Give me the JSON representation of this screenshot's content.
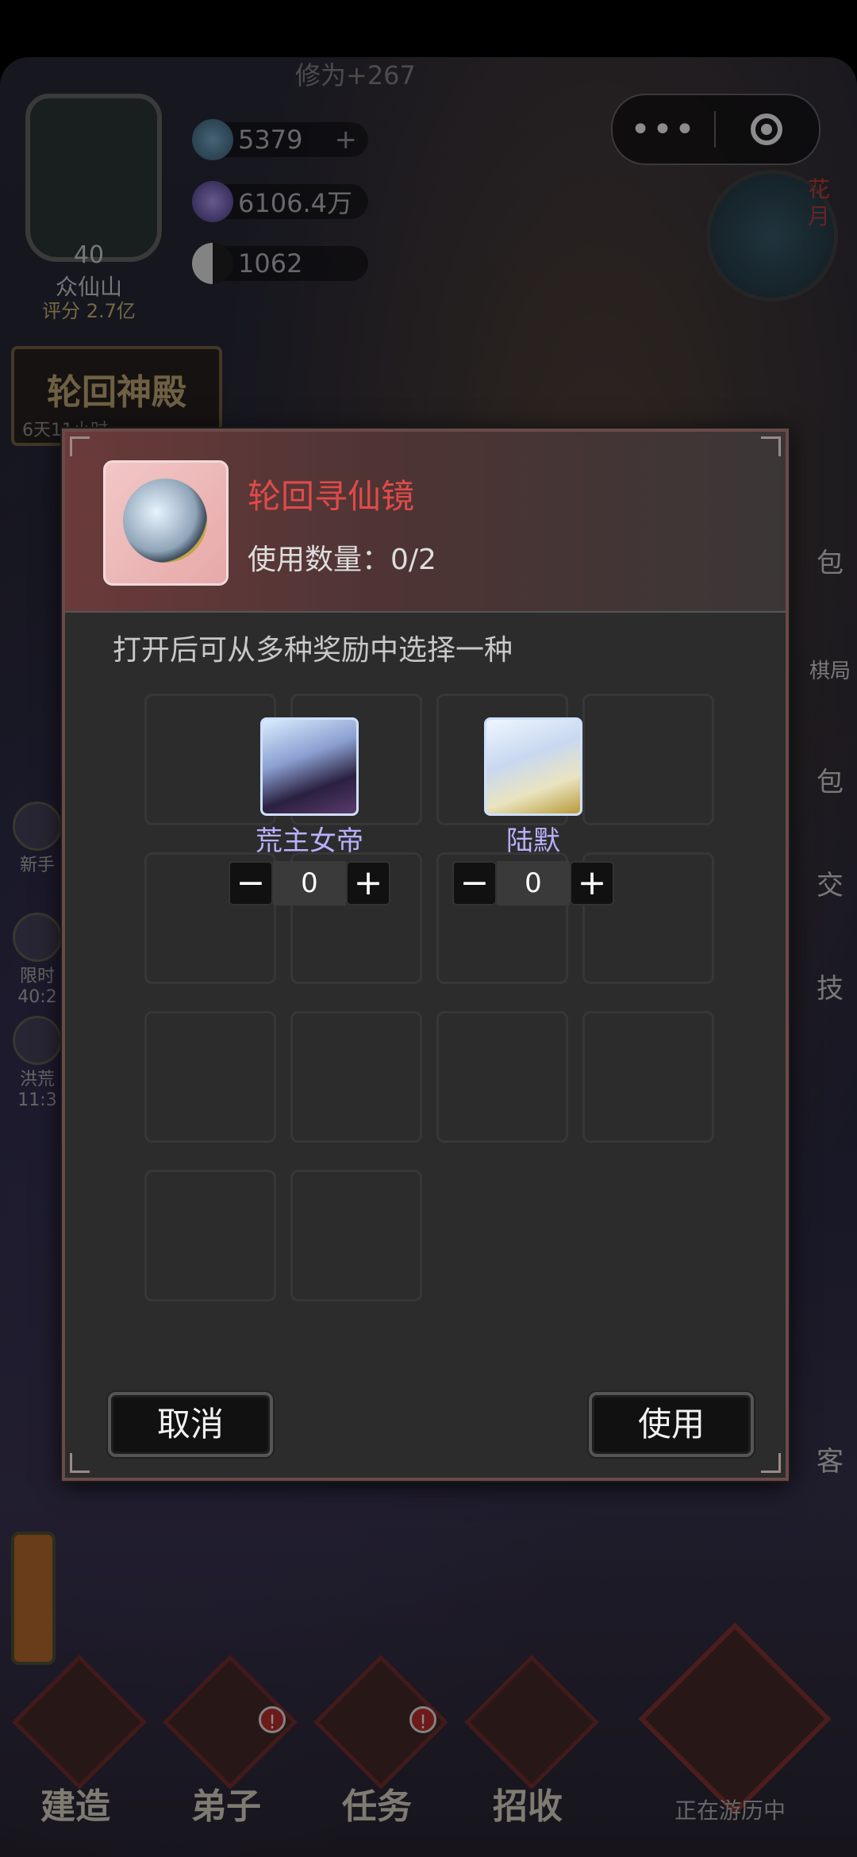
{
  "hud": {
    "top_banner": "修为+267",
    "sect": {
      "level": "40",
      "name": "众仙山",
      "score": "评分 2.7亿"
    },
    "resources": [
      {
        "icon": "spirit-stone-icon",
        "value": "5379",
        "plus": "+"
      },
      {
        "icon": "crystal-orb-icon",
        "value": "6106.4万"
      },
      {
        "icon": "yin-yang-icon",
        "value": "1062"
      }
    ],
    "hall": {
      "title": "轮回神殿",
      "timer": "6天11小时"
    },
    "clock_tag": "花月"
  },
  "capsule": {
    "more": "•••"
  },
  "side_left": [
    {
      "label": "新手"
    },
    {
      "label": "限时",
      "timer": "40:2"
    },
    {
      "label": "洪荒",
      "timer": "11:3"
    }
  ],
  "side_right": [
    {
      "label": "包"
    },
    {
      "label": "棋局"
    },
    {
      "label": "包"
    },
    {
      "label": "交"
    },
    {
      "label": "技"
    },
    {
      "label": "客"
    }
  ],
  "dialog": {
    "item_name": "轮回寻仙镜",
    "usage_label": "使用数量：0/2",
    "description": "打开后可从多种奖励中选择一种",
    "rewards": [
      {
        "name": "荒主女帝",
        "count": "0"
      },
      {
        "name": "陆默",
        "count": "0"
      }
    ],
    "minus": "−",
    "plus": "+",
    "cancel": "取消",
    "confirm": "使用"
  },
  "nav": {
    "items": [
      {
        "label": "建造",
        "badge": ""
      },
      {
        "label": "弟子",
        "badge": "!"
      },
      {
        "label": "任务",
        "badge": "!"
      },
      {
        "label": "招收",
        "badge": ""
      }
    ],
    "travel": "正在游历中"
  },
  "colors": {
    "item_name": "#e04a4a",
    "reward_name": "#b9b0ff",
    "dialog_bg": "#2c2c2c",
    "header_tint": "#6b3a3a"
  }
}
